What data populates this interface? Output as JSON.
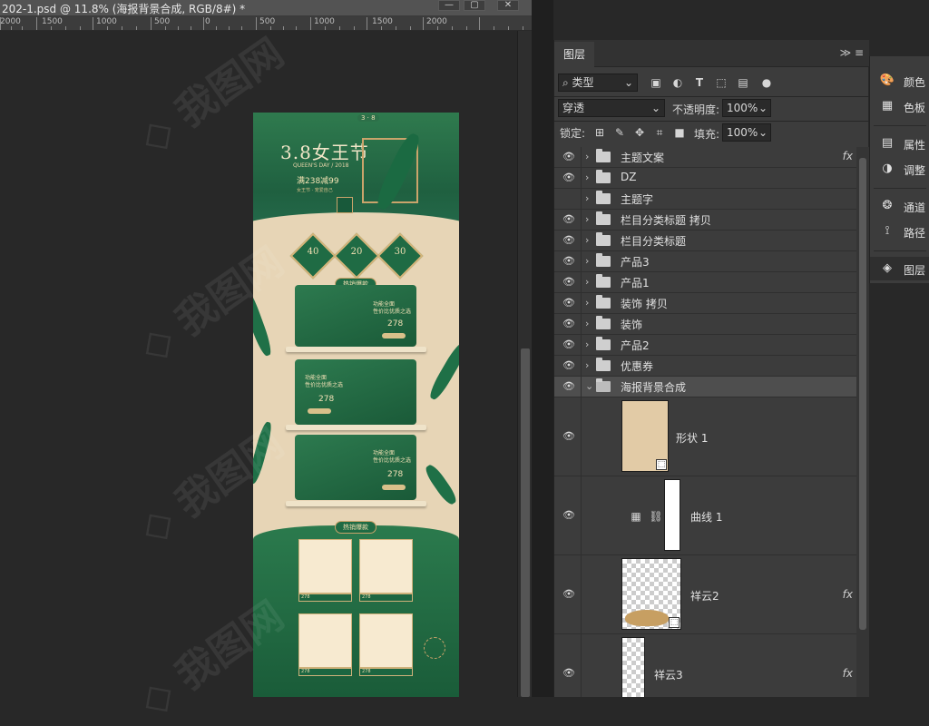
{
  "document": {
    "title": "202-1.psd @ 11.8% (海报背景合成, RGB/8#) *",
    "window_buttons": [
      "—",
      "▢",
      "✕"
    ]
  },
  "ruler": {
    "labels": [
      {
        "text": "2000"
      },
      {
        "text": "1500"
      },
      {
        "text": "1000"
      },
      {
        "text": "500"
      },
      {
        "text": "0"
      },
      {
        "text": "500"
      },
      {
        "text": "1000"
      },
      {
        "text": "1500"
      },
      {
        "text": "2000"
      }
    ]
  },
  "poster": {
    "title": "3.8女王节",
    "subtitle": "QUEEN'S DAY / 2018",
    "promo": "满238减99",
    "promo_sub": "女王节 · 宠爱自己",
    "top_tag": "3 · 8",
    "coupons": [
      "40",
      "20",
      "30"
    ],
    "section_tags": [
      "热销爆款",
      "热销爆款"
    ],
    "panel_texts": [
      "功能全面\n性价比优质之选",
      "功能全面\n性价比优质之选",
      "功能全面\n性价比优质之选"
    ],
    "price": "278",
    "card_prices": [
      "278",
      "278",
      "278",
      "278"
    ]
  },
  "layers_panel": {
    "tab_label": "图层",
    "menu_icons": "≫  ≡",
    "filter": {
      "label": "类型"
    },
    "blend_mode": "穿透",
    "opacity_label": "不透明度:",
    "opacity_value": "100%",
    "lock_label": "锁定:",
    "fill_label": "填充:",
    "fill_value": "100%",
    "layers": [
      {
        "name": "主题文案",
        "visible": true,
        "fx": "fx"
      },
      {
        "name": "DZ",
        "visible": true,
        "fx": ""
      },
      {
        "name": "主题字",
        "visible": false,
        "fx": ""
      },
      {
        "name": "栏目分类标题 拷贝",
        "visible": true,
        "fx": ""
      },
      {
        "name": "栏目分类标题",
        "visible": true,
        "fx": ""
      },
      {
        "name": "产品3",
        "visible": true,
        "fx": ""
      },
      {
        "name": "产品1",
        "visible": true,
        "fx": ""
      },
      {
        "name": "装饰 拷贝",
        "visible": true,
        "fx": ""
      },
      {
        "name": "装饰",
        "visible": true,
        "fx": ""
      },
      {
        "name": "产品2",
        "visible": true,
        "fx": ""
      },
      {
        "name": "优惠券",
        "visible": true,
        "fx": ""
      },
      {
        "name": "海报背景合成",
        "visible": true,
        "fx": "",
        "expanded": true,
        "selected": true
      }
    ],
    "child_layers": [
      {
        "name": "形状 1",
        "fx": ""
      },
      {
        "name": "曲线 1",
        "fx": ""
      },
      {
        "name": "祥云2",
        "fx": "fx"
      },
      {
        "name": "祥云3",
        "fx": "fx"
      }
    ]
  },
  "dock": {
    "items": [
      {
        "icon": "palette-icon",
        "label": "颜色"
      },
      {
        "icon": "swatches-icon",
        "label": "色板"
      },
      {
        "icon": "properties-icon",
        "label": "属性"
      },
      {
        "icon": "adjustments-icon",
        "label": "调整"
      },
      {
        "icon": "channels-icon",
        "label": "通道"
      },
      {
        "icon": "paths-icon",
        "label": "路径"
      },
      {
        "icon": "layers-icon",
        "label": "图层"
      }
    ]
  }
}
